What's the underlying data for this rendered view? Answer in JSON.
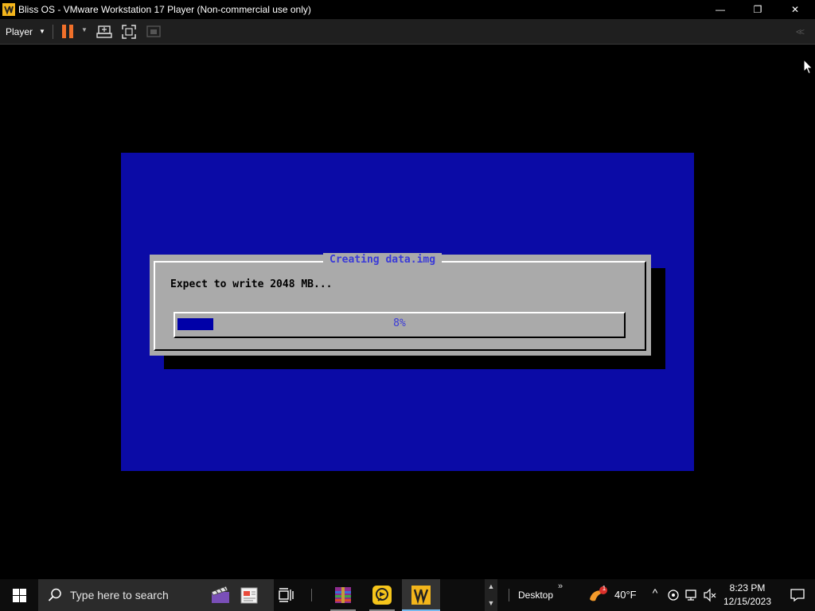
{
  "window": {
    "title": "Bliss OS - VMware Workstation 17 Player (Non-commercial use only)",
    "minimize_glyph": "—",
    "restore_glyph": "❐",
    "close_glyph": "✕"
  },
  "toolbar": {
    "player_menu_label": "Player",
    "caret_glyph": "▼",
    "collapse_glyph": "<<",
    "accent_color": "#f0702a"
  },
  "vm": {
    "screen_color": "#0b0ba6",
    "dialog": {
      "title": "Creating data.img",
      "message": "Expect to write 2048 MB...",
      "progress_percent": 8,
      "progress_label": "8%"
    }
  },
  "taskbar": {
    "search_placeholder": "Type here to search",
    "desktop_label": "Desktop",
    "desktop_chevron": "»",
    "weather": {
      "temperature": "40°F",
      "badge": "1"
    },
    "clock": {
      "time": "8:23 PM",
      "date": "12/15/2023"
    },
    "scroll_up": "▲",
    "scroll_down": "▼",
    "tray_up_arrow": "^"
  }
}
